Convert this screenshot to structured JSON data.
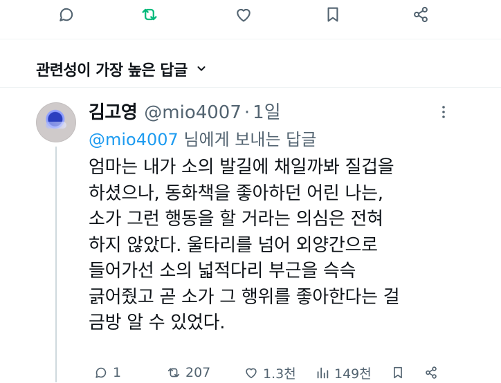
{
  "sort": {
    "label": "관련성이 가장 높은 답글"
  },
  "reply": {
    "name": "김고영",
    "handle": "@mio4007",
    "dot": "·",
    "time": "1일",
    "replying_to_handle": "@mio4007",
    "replying_to_suffix": " 님에게 보내는 답글",
    "text": "엄마는 내가 소의 발길에 채일까봐 질겁을\n하셨으나, 동화책을 좋아하던 어린 나는,\n소가 그런 행동을 할 거라는 의심은 전혀\n하지 않았다. 울타리를 넘어 외양간으로\n들어가선 소의 넓적다리 부근을 슥슥\n긁어줬고 곧 소가 그 행위를 좋아한다는 걸\n금방 알 수 있었다.",
    "stats": {
      "replies": "1",
      "reposts": "207",
      "likes": "1.3천",
      "views": "149천"
    }
  },
  "colors": {
    "repost_active": "#00ba7c",
    "link": "#1d9bf0",
    "muted": "#536471"
  }
}
